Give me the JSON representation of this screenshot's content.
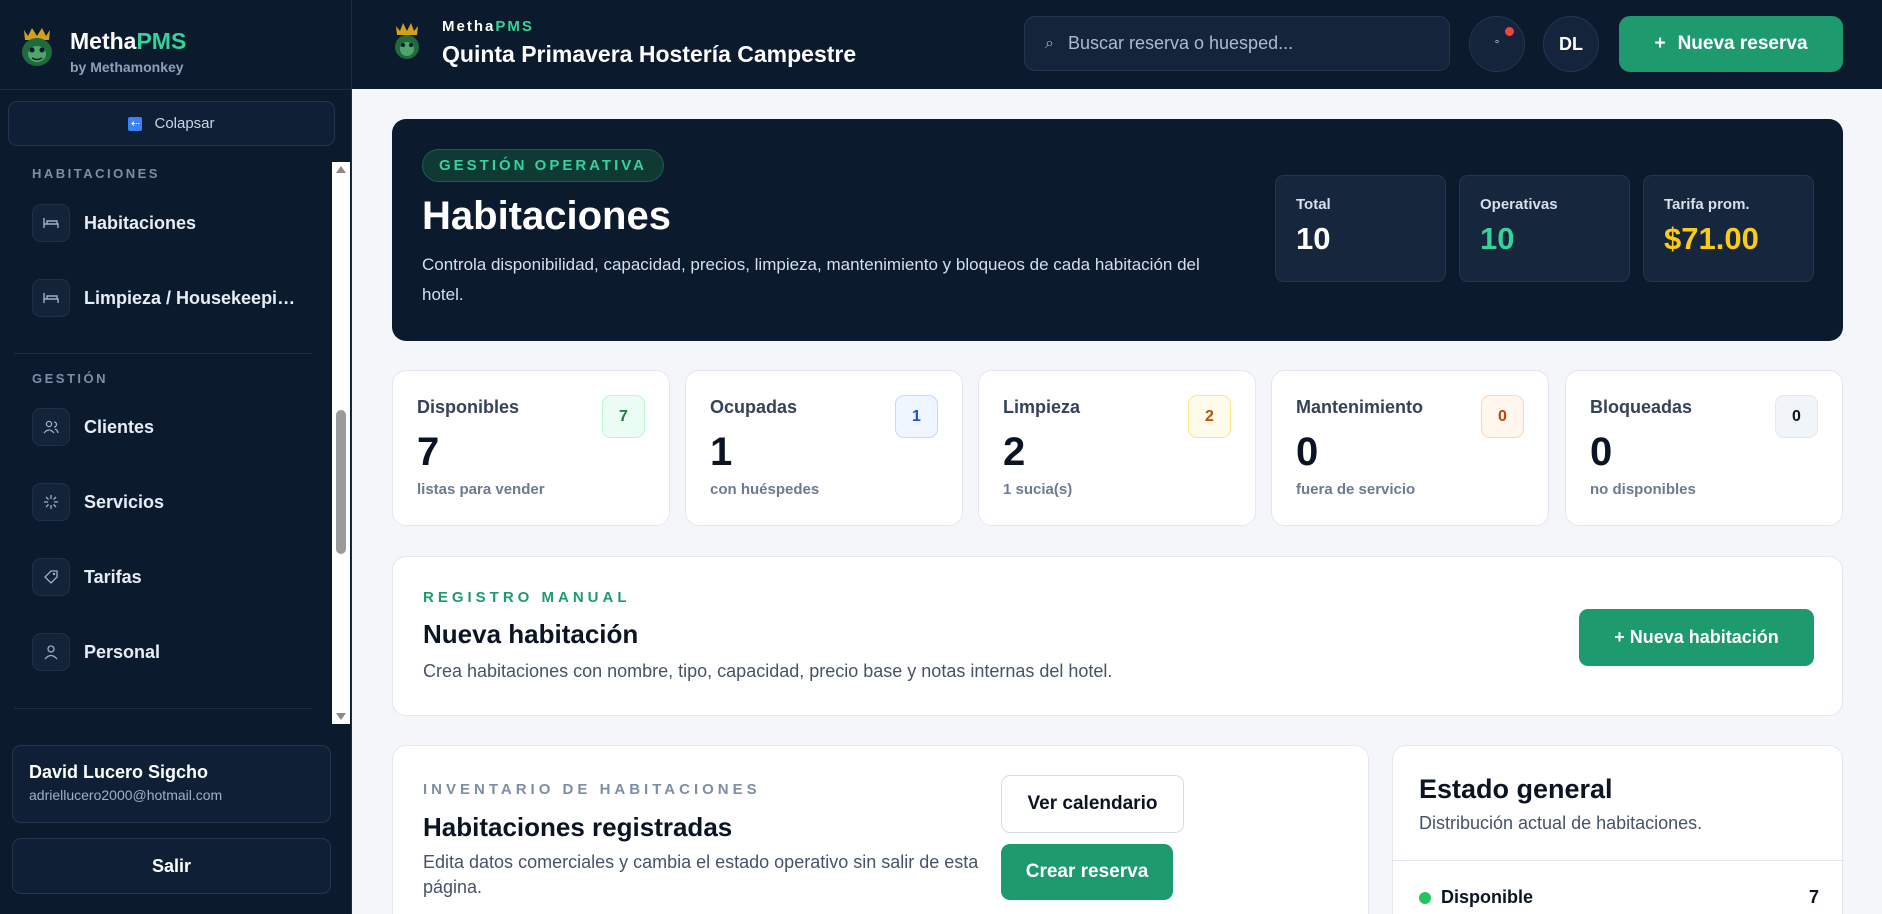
{
  "sidebar": {
    "brand_name_a": "Metha",
    "brand_name_b": "PMS",
    "brand_sub": "by Methamonkey",
    "collapse_label": "Colapsar",
    "sections": [
      {
        "title": "HABITACIONES",
        "items": [
          {
            "label": "Habitaciones",
            "icon": "bed-icon"
          },
          {
            "label": "Limpieza / Housekeeping",
            "icon": "bed-icon"
          }
        ]
      },
      {
        "title": "GESTIÓN",
        "items": [
          {
            "label": "Clientes",
            "icon": "users-icon"
          },
          {
            "label": "Servicios",
            "icon": "sparkle-icon"
          },
          {
            "label": "Tarifas",
            "icon": "tag-icon"
          },
          {
            "label": "Personal",
            "icon": "user-icon"
          }
        ]
      }
    ],
    "user": {
      "name": "David Lucero Sigcho",
      "email": "adriellucero2000@hotmail.com"
    },
    "logout_label": "Salir"
  },
  "topbar": {
    "brand_a": "Metha",
    "brand_b": "PMS",
    "hotel_name": "Quinta Primavera Hostería Campestre",
    "search_placeholder": "Buscar reserva o huesped...",
    "notif_symbol": "°",
    "avatar_initials": "DL",
    "new_reservation_label": "Nueva reserva",
    "new_reservation_plus": "+"
  },
  "hero": {
    "badge": "GESTIÓN OPERATIVA",
    "title": "Habitaciones",
    "description": "Controla disponibilidad, capacidad, precios, limpieza, mantenimiento y bloqueos de cada habitación del hotel.",
    "stats": [
      {
        "label": "Total",
        "value": "10",
        "color": "#ffffff"
      },
      {
        "label": "Operativas",
        "value": "10",
        "color": "#34d399"
      },
      {
        "label": "Tarifa prom.",
        "value": "$71.00",
        "color": "#facc15"
      }
    ]
  },
  "kpis": [
    {
      "label": "Disponibles",
      "value": "7",
      "sub": "listas para vender",
      "badge": "7",
      "badge_bg": "#ecfdf5",
      "badge_fg": "#15803d",
      "badge_border": "#bbf7d0"
    },
    {
      "label": "Ocupadas",
      "value": "1",
      "sub": "con huéspedes",
      "badge": "1",
      "badge_bg": "#eff6ff",
      "badge_fg": "#1d4ed8",
      "badge_border": "#bfdbfe"
    },
    {
      "label": "Limpieza",
      "value": "2",
      "sub": "1 sucia(s)",
      "badge": "2",
      "badge_bg": "#fffbeb",
      "badge_fg": "#b45309",
      "badge_border": "#fde68a"
    },
    {
      "label": "Mantenimiento",
      "value": "0",
      "sub": "fuera de servicio",
      "badge": "0",
      "badge_bg": "#fff7ed",
      "badge_fg": "#c2410c",
      "badge_border": "#fed7aa"
    },
    {
      "label": "Bloqueadas",
      "value": "0",
      "sub": "no disponibles",
      "badge": "0",
      "badge_bg": "#f1f5f9",
      "badge_fg": "#0b1424",
      "badge_border": "#e2e8f0"
    }
  ],
  "manual": {
    "eyebrow": "REGISTRO MANUAL",
    "title": "Nueva habitación",
    "description": "Crea habitaciones con nombre, tipo, capacidad, precio base y notas internas del hotel.",
    "button_label": "+ Nueva habitación"
  },
  "inventory": {
    "eyebrow": "INVENTARIO DE HABITACIONES",
    "title": "Habitaciones registradas",
    "description": "Edita datos comerciales y cambia el estado operativo sin salir de esta página.",
    "calendar_label": "Ver calendario",
    "create_label": "Crear reserva"
  },
  "status": {
    "title": "Estado general",
    "description": "Distribución actual de habitaciones.",
    "rows": [
      {
        "label": "Disponible",
        "value": "7",
        "color": "#22c55e"
      }
    ]
  }
}
